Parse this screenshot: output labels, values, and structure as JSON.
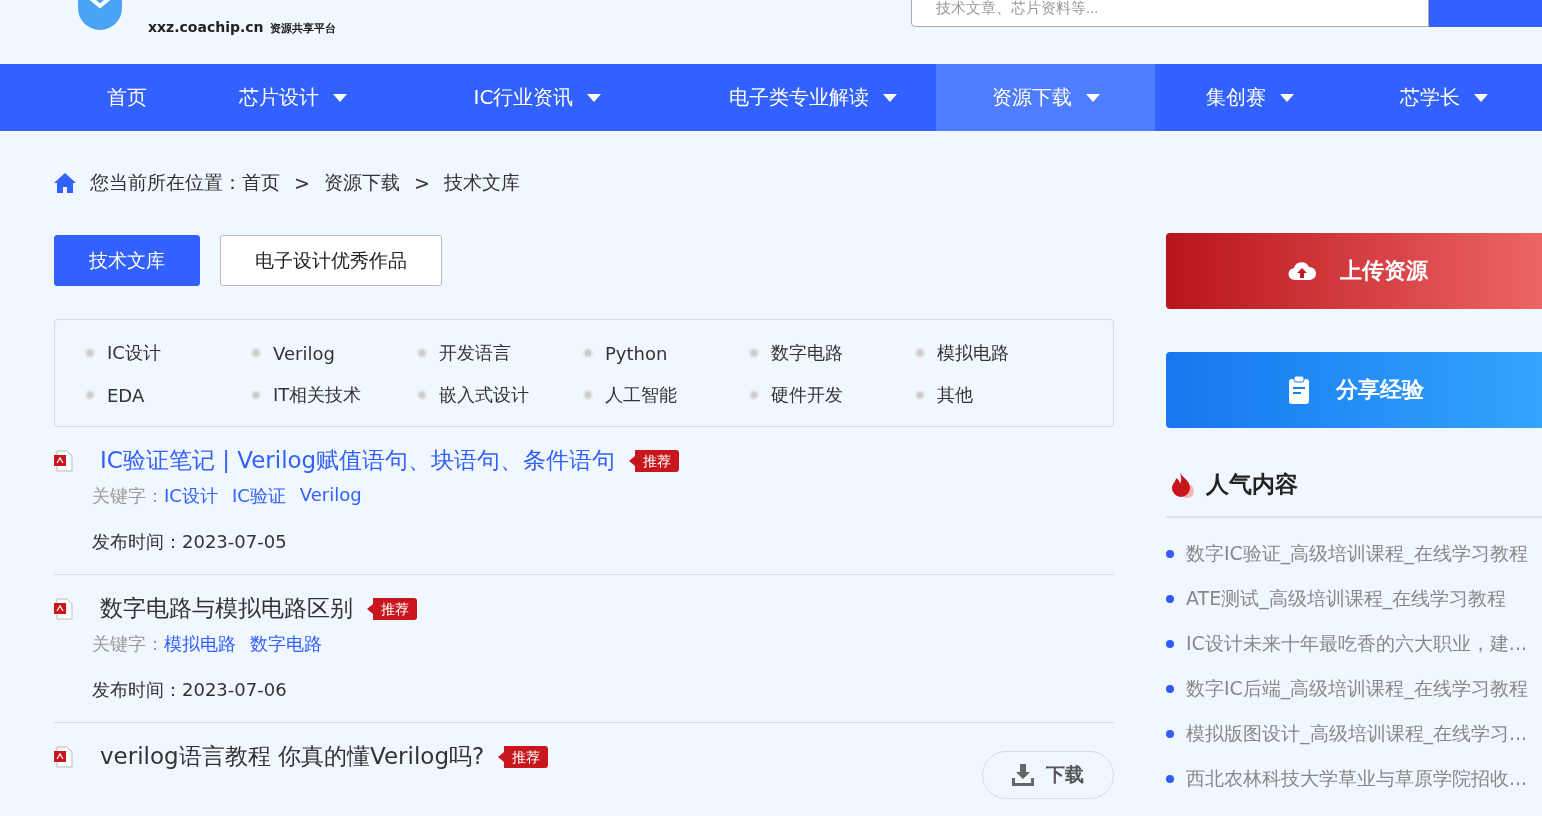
{
  "header": {
    "logo_domain": "xxz.coachip.cn",
    "logo_tagline": "资源共享平台",
    "search": {
      "placeholder": "技术文章、芯片资料等..."
    }
  },
  "nav": [
    {
      "label": "首页",
      "dropdown": false,
      "selected": false
    },
    {
      "label": "芯片设计",
      "dropdown": true,
      "selected": false
    },
    {
      "label": "IC行业资讯",
      "dropdown": true,
      "selected": false
    },
    {
      "label": "电子类专业解读",
      "dropdown": true,
      "selected": false
    },
    {
      "label": "资源下载",
      "dropdown": true,
      "selected": true
    },
    {
      "label": "集创赛",
      "dropdown": true,
      "selected": false
    },
    {
      "label": "芯学长",
      "dropdown": true,
      "selected": false
    }
  ],
  "breadcrumb": {
    "prefix": "您当前所在位置：",
    "items": [
      "首页",
      "资源下载",
      "技术文库"
    ],
    "separator": ">"
  },
  "tabs": [
    {
      "label": "技术文库",
      "selected": true
    },
    {
      "label": "电子设计优秀作品",
      "selected": false
    }
  ],
  "categories": [
    "IC设计",
    "Verilog",
    "开发语言",
    "Python",
    "数字电路",
    "模拟电路",
    "EDA",
    "IT相关技术",
    "嵌入式设计",
    "人工智能",
    "硬件开发",
    "其他"
  ],
  "articles": [
    {
      "title": "IC验证笔记 | Verilog赋值语句、块语句、条件语句",
      "highlighted": true,
      "badge": "推荐",
      "keywords_label": "关键字：",
      "keywords": [
        "IC设计",
        "IC验证",
        "Verilog"
      ],
      "date": "发布时间：2023-07-05"
    },
    {
      "title": "数字电路与模拟电路区别",
      "highlighted": false,
      "badge": "推荐",
      "keywords_label": "关键字：",
      "keywords": [
        "模拟电路",
        "数字电路"
      ],
      "date": "发布时间：2023-07-06"
    },
    {
      "title": "verilog语言教程 你真的懂Verilog吗?",
      "highlighted": false,
      "badge": "推荐",
      "download": "下载"
    }
  ],
  "sidebar": {
    "actions": [
      {
        "kind": "upload",
        "label": "上传资源"
      },
      {
        "kind": "share",
        "label": "分享经验"
      }
    ],
    "popular_title": "人气内容",
    "popular": [
      "数字IC验证_高级培训课程_在线学习教程",
      "ATE测试_高级培训课程_在线学习教程",
      "IC设计未来十年最吃香的六大职业，建...",
      "数字IC后端_高级培训课程_在线学习教程",
      "模拟版图设计_高级培训课程_在线学习...",
      "西北农林科技大学草业与草原学院招收..."
    ]
  }
}
